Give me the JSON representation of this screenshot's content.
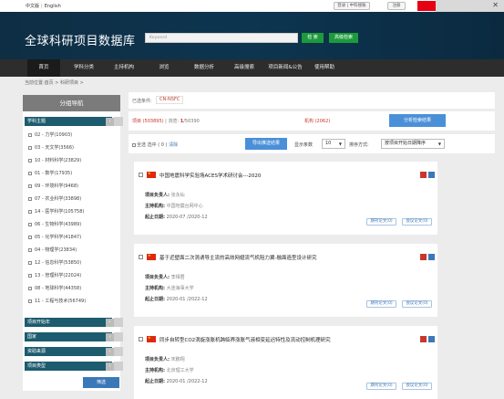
{
  "topbar": {
    "lang_zh": "中文版",
    "lang_en": "English",
    "btn_login": "登录 | 中科搜账",
    "btn_register": "注册"
  },
  "header": {
    "site_title": "全球科研项目数据库",
    "search_placeholder": "Keyword",
    "search_btn": "检 索",
    "adv_search_btn": "高级检索"
  },
  "nav": {
    "items": [
      "首页",
      "学科分类",
      "主持机构",
      "浏览",
      "数据分析",
      "高级搜索",
      "项目新闻&公告",
      "使用帮助"
    ]
  },
  "breadcrumb": "当前位置:首页 > 科研项目 >",
  "sidebar": {
    "title": "分组导航",
    "section_subject": "学科主题",
    "categories": [
      "02 - 力学(10903)",
      "03 - 天文学(3566)",
      "10 - 材料科学(23829)",
      "01 - 数学(17935)",
      "09 - 环境科学(9468)",
      "07 - 农业科学(33898)",
      "14 - 医学科学(105758)",
      "06 - 生物科学(43989)",
      "05 - 化学科学(41847)",
      "04 - 物理学(23834)",
      "12 - 信息科学(53850)",
      "13 - 管理科学(22024)",
      "08 - 地球科学(44358)",
      "11 - 工程与技术(56749)"
    ],
    "section_year": "项目开始年",
    "section_country": "国家",
    "section_source": "资助来源",
    "section_type": "项目类型",
    "filter_btn": "筛选"
  },
  "main": {
    "condition_label": "已选条件:",
    "condition_tag": "CN-NSFC",
    "stat_projects": "项目 (503895)",
    "stat_browse_label": "浏览:",
    "stat_page_current": "1",
    "stat_page_total": "/50390",
    "stat_org": "机构 (2062)",
    "analysis_btn": "分析检索结果",
    "select_all": "全选",
    "selected_label": "选中 ( 0 )",
    "clear": "清除",
    "export_btn": "导出推送结果",
    "page_size_label": "显示条数",
    "page_size_value": "10",
    "sort_label": "排序方式:",
    "sort_value": "按项目开始日期降序"
  },
  "results": [
    {
      "title": "中国地震科学实验场ACES学术研讨会---2020",
      "leader_label": "项目负责人:",
      "leader": "张永仙",
      "org_label": "主持机构:",
      "org": "中国地震台网中心",
      "date_label": "起止日期:",
      "dates": "2020-07 /2020-12",
      "btn_paper": "期刊论文(0)",
      "btn_conf": "会议论文(0)"
    },
    {
      "title": "基于近壁面二次涡诱导主流的高效网翅流气机阻力翼-融面造型设计研究",
      "leader_label": "项目负责人:",
      "leader": "李相君",
      "org_label": "主持机构:",
      "org": "大连海事大学",
      "date_label": "起止日期:",
      "dates": "2020-01 /2022-12",
      "btn_paper": "期刊论文(0)",
      "btn_conf": "会议论文(0)"
    },
    {
      "title": "同步自转型CO2涡旋涨胀机跨临界涨胀气液相变延迟特性及流动控制机理研究",
      "leader_label": "项目负责人:",
      "leader": "宋鹏翔",
      "org_label": "主持机构:",
      "org": "北京理工大学",
      "date_label": "起止日期:",
      "dates": "2020-01 /2022-12",
      "btn_paper": "期刊论文(0)",
      "btn_conf": "会议论文(0)"
    }
  ],
  "colors": {
    "nav_bg": "#2d2d2d",
    "header_bg": "#0d3550",
    "accent_green": "#1c9a3c",
    "accent_blue": "#4a90d9",
    "section_teal": "#1d5b6e",
    "highlight_red": "#c8372d"
  }
}
